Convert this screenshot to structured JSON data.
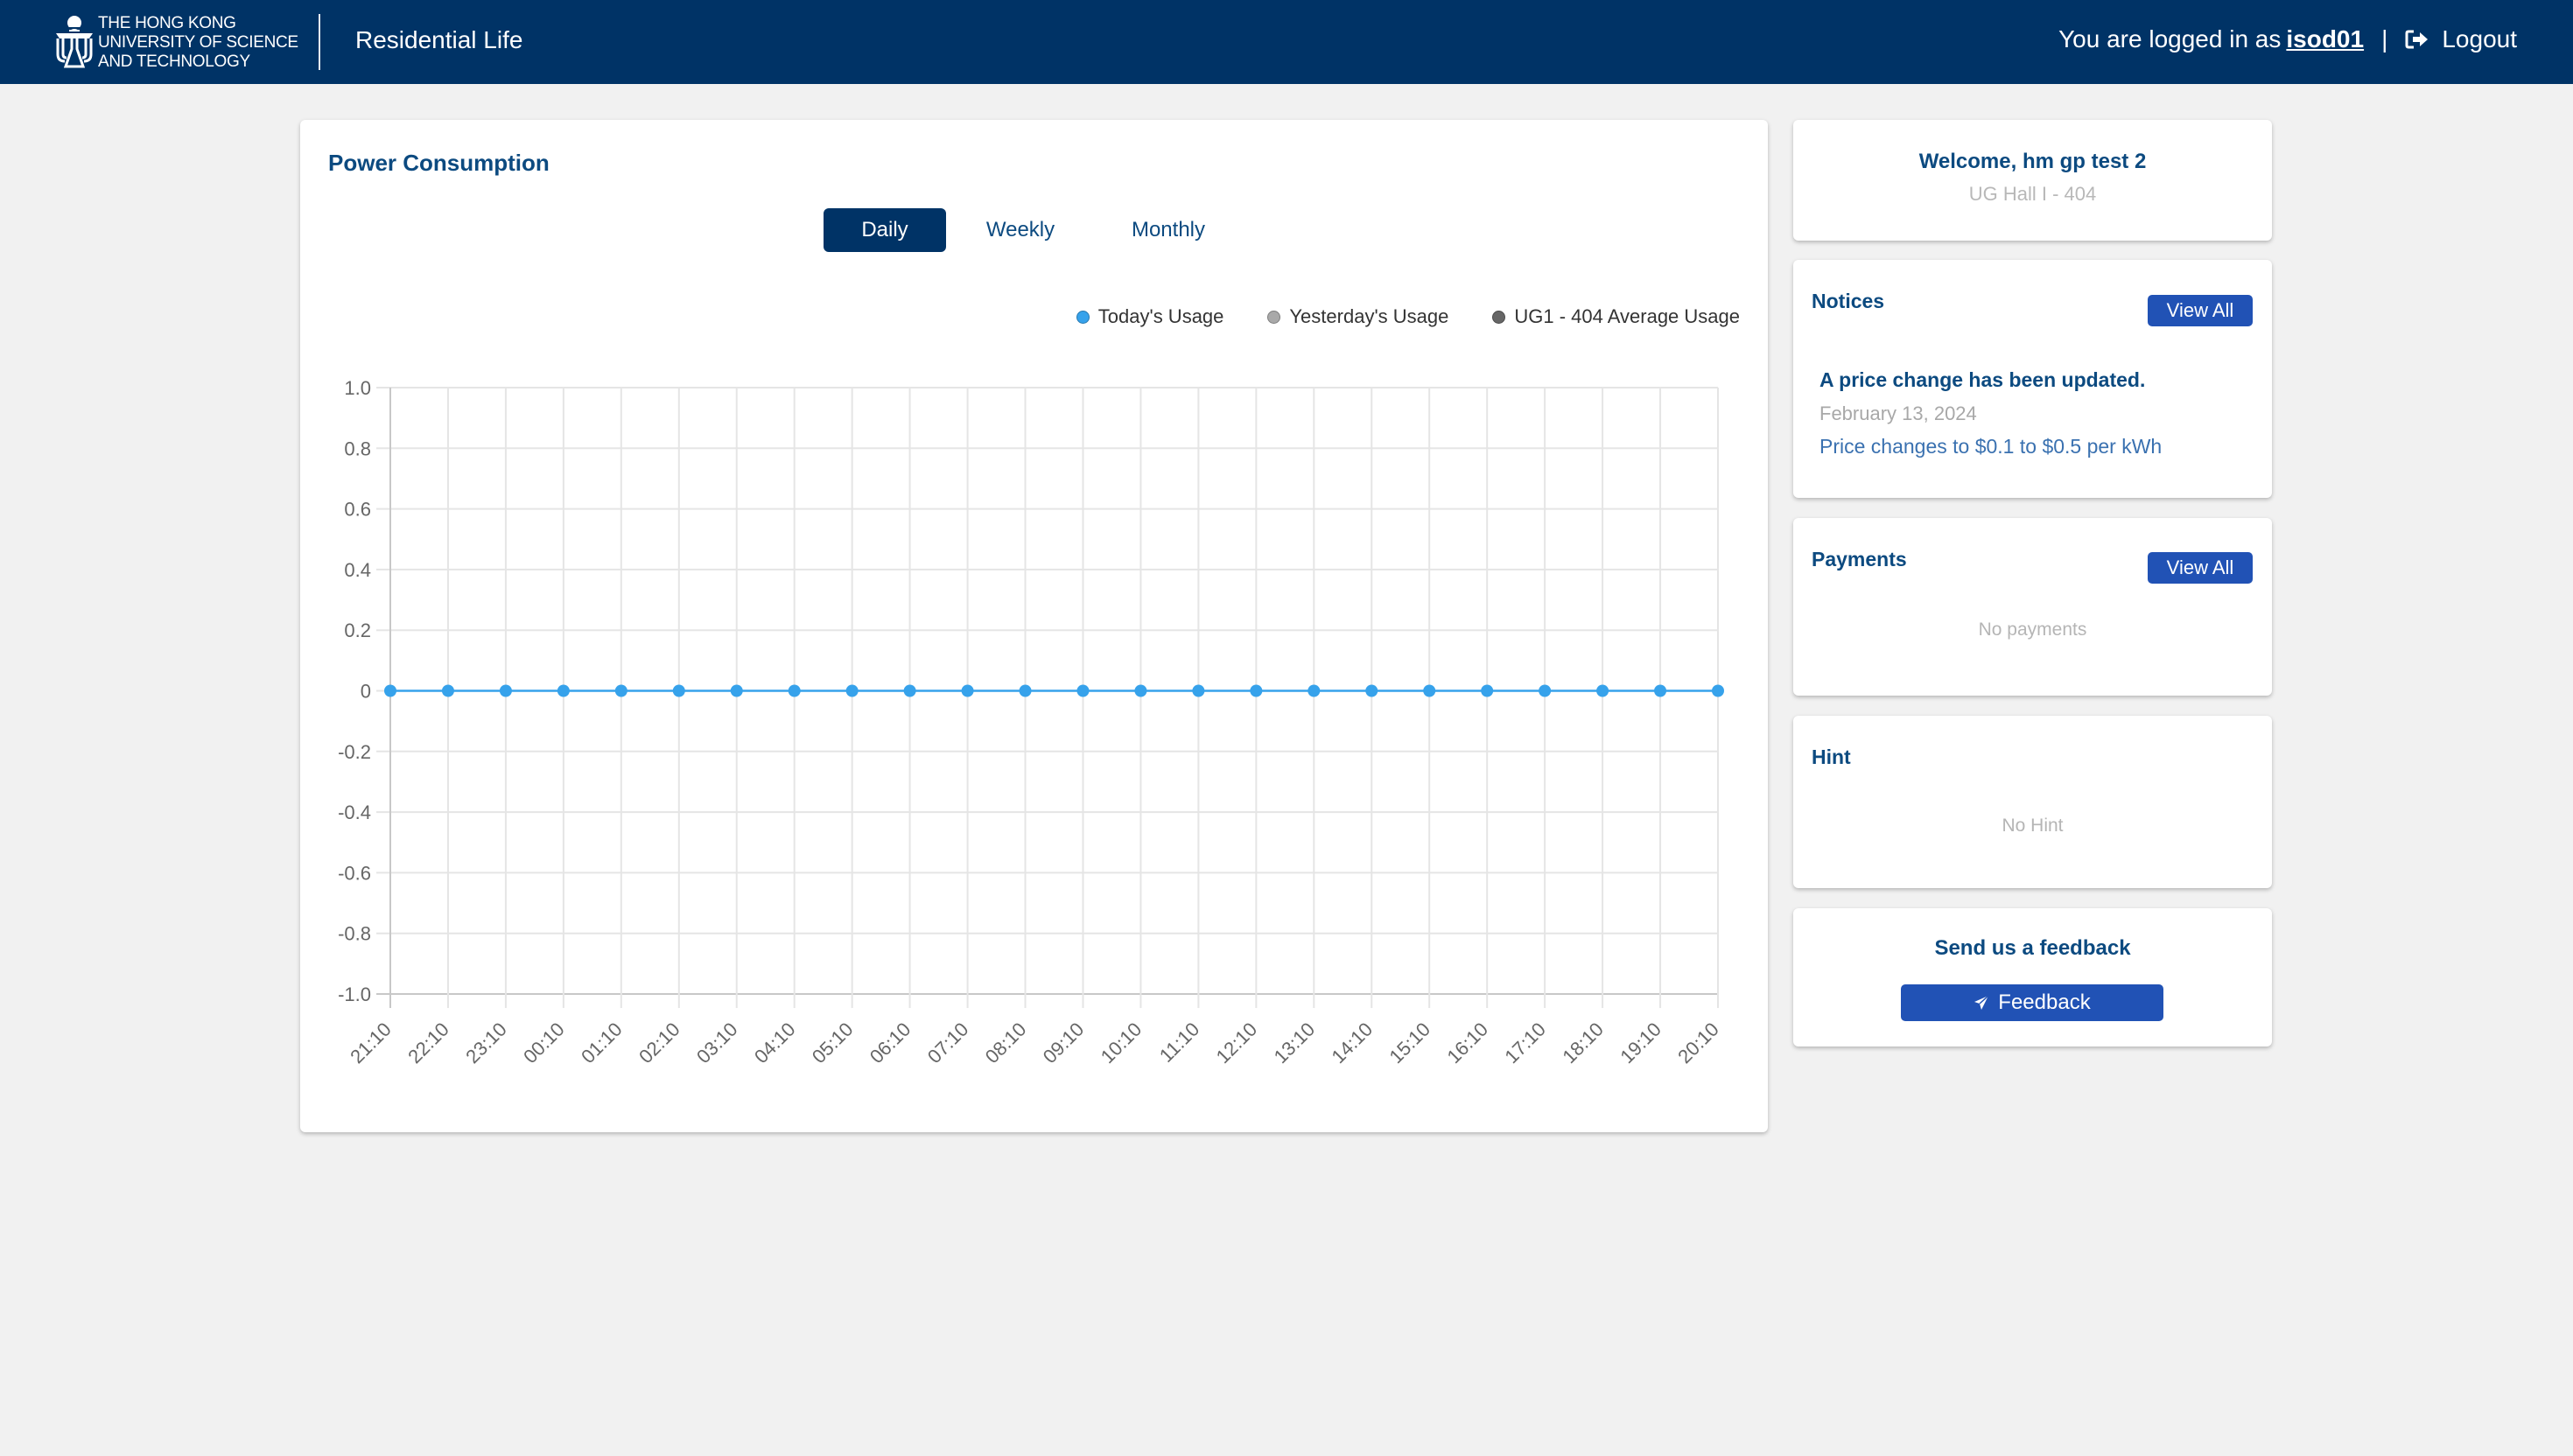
{
  "header": {
    "university_lines": [
      "THE HONG KONG",
      "UNIVERSITY OF SCIENCE",
      "AND TECHNOLOGY"
    ],
    "app_title": "Residential Life",
    "logged_in_prefix": "You are logged in as",
    "username": "isod01",
    "separator": "|",
    "logout_label": "Logout",
    "bg_color": "#003366"
  },
  "power": {
    "title": "Power Consumption",
    "tabs": [
      {
        "label": "Daily",
        "active": true
      },
      {
        "label": "Weekly",
        "active": false
      },
      {
        "label": "Monthly",
        "active": false
      }
    ]
  },
  "chart_data": {
    "type": "line",
    "title": "Power Consumption",
    "xlabel": "",
    "ylabel": "",
    "x": [
      "21:10",
      "22:10",
      "23:10",
      "00:10",
      "01:10",
      "02:10",
      "03:10",
      "04:10",
      "05:10",
      "06:10",
      "07:10",
      "08:10",
      "09:10",
      "10:10",
      "11:10",
      "12:10",
      "13:10",
      "14:10",
      "15:10",
      "16:10",
      "17:10",
      "18:10",
      "19:10",
      "20:10"
    ],
    "series": [
      {
        "name": "Today's Usage",
        "color": "#36a2eb",
        "values": [
          0,
          0,
          0,
          0,
          0,
          0,
          0,
          0,
          0,
          0,
          0,
          0,
          0,
          0,
          0,
          0,
          0,
          0,
          0,
          0,
          0,
          0,
          0,
          0
        ]
      },
      {
        "name": "Yesterday's Usage",
        "color": "#a9a9a9",
        "values": []
      },
      {
        "name": "UG1 - 404 Average Usage",
        "color": "#666666",
        "values": []
      }
    ],
    "ylim": [
      -1.0,
      1.0
    ],
    "yticks": [
      "1.0",
      "0.8",
      "0.6",
      "0.4",
      "0.2",
      "0",
      "-0.2",
      "-0.4",
      "-0.6",
      "-0.8",
      "-1.0"
    ],
    "ytick_values": [
      1.0,
      0.8,
      0.6,
      0.4,
      0.2,
      0,
      -0.2,
      -0.4,
      -0.6,
      -0.8,
      -1.0
    ],
    "grid": true,
    "legend_position": "top-right"
  },
  "welcome": {
    "title": "Welcome, hm gp test 2",
    "subtitle": "UG Hall I - 404"
  },
  "notices": {
    "title": "Notices",
    "view_all": "View All",
    "items": [
      {
        "title": "A price change has been updated.",
        "date": "February 13, 2024",
        "body": "Price changes to $0.1 to $0.5 per kWh"
      }
    ]
  },
  "payments": {
    "title": "Payments",
    "view_all": "View All",
    "empty": "No payments"
  },
  "hint": {
    "title": "Hint",
    "empty": "No Hint"
  },
  "feedback": {
    "title": "Send us a feedback",
    "button_label": "Feedback"
  }
}
